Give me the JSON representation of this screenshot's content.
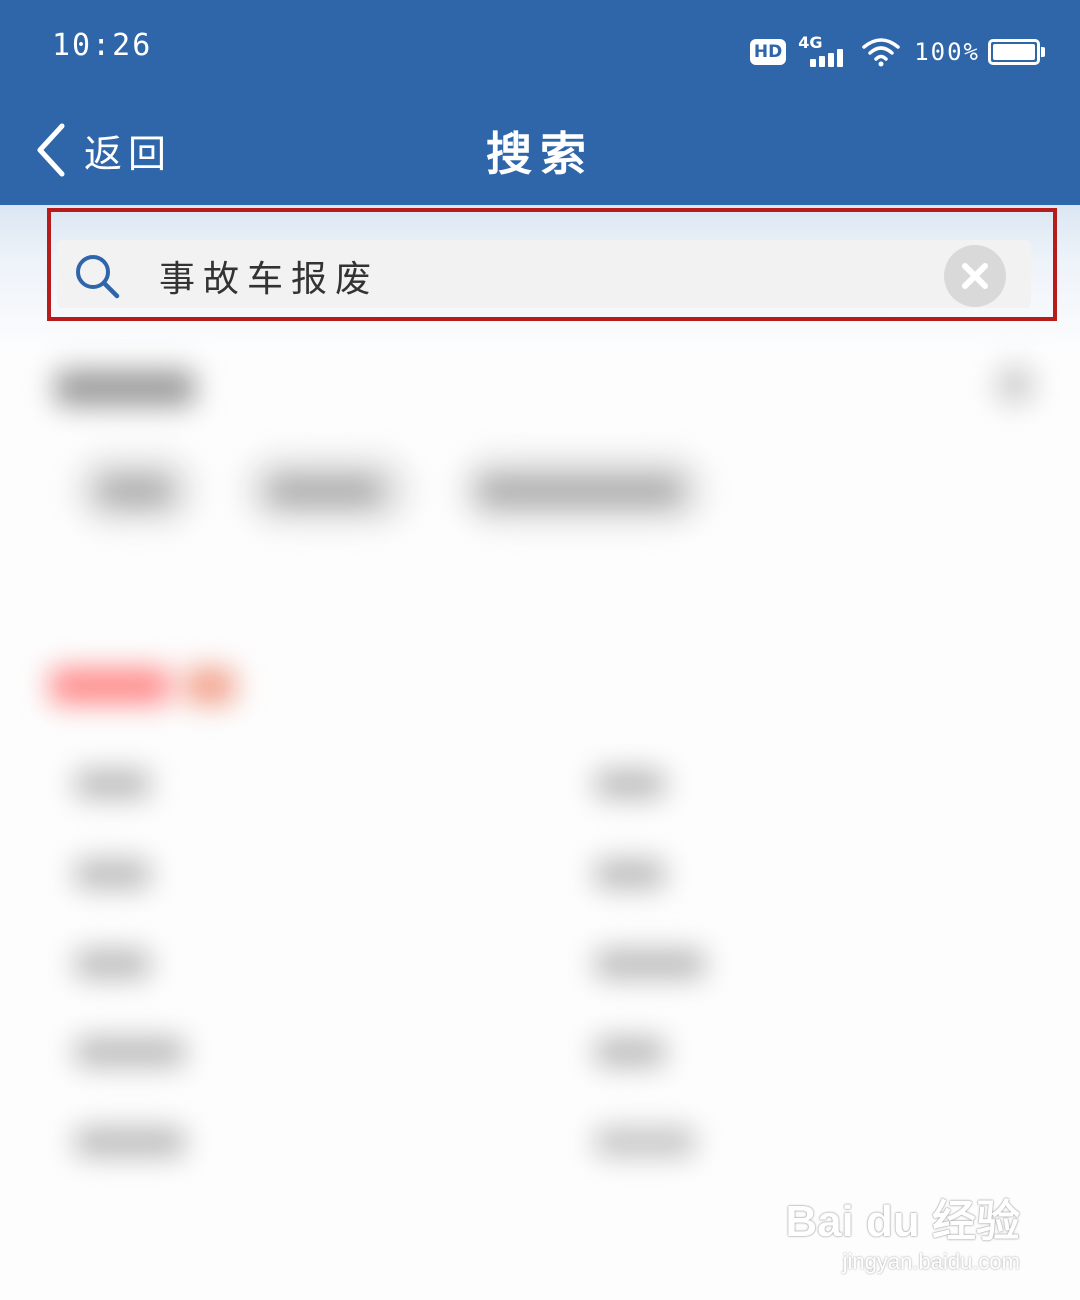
{
  "status_bar": {
    "time": "10:26",
    "hd_badge": "HD",
    "network": "4G",
    "battery_percent": "100%"
  },
  "header": {
    "back_label": "返回",
    "title": "搜索",
    "background_color": "#2f66aa"
  },
  "search": {
    "value": "事故车报废",
    "highlight_color": "#b71c1c",
    "icon": "search-icon",
    "clear_icon": "close-icon"
  },
  "watermark": {
    "brand": "Bai du 经验",
    "url": "jingyan.baidu.com"
  }
}
